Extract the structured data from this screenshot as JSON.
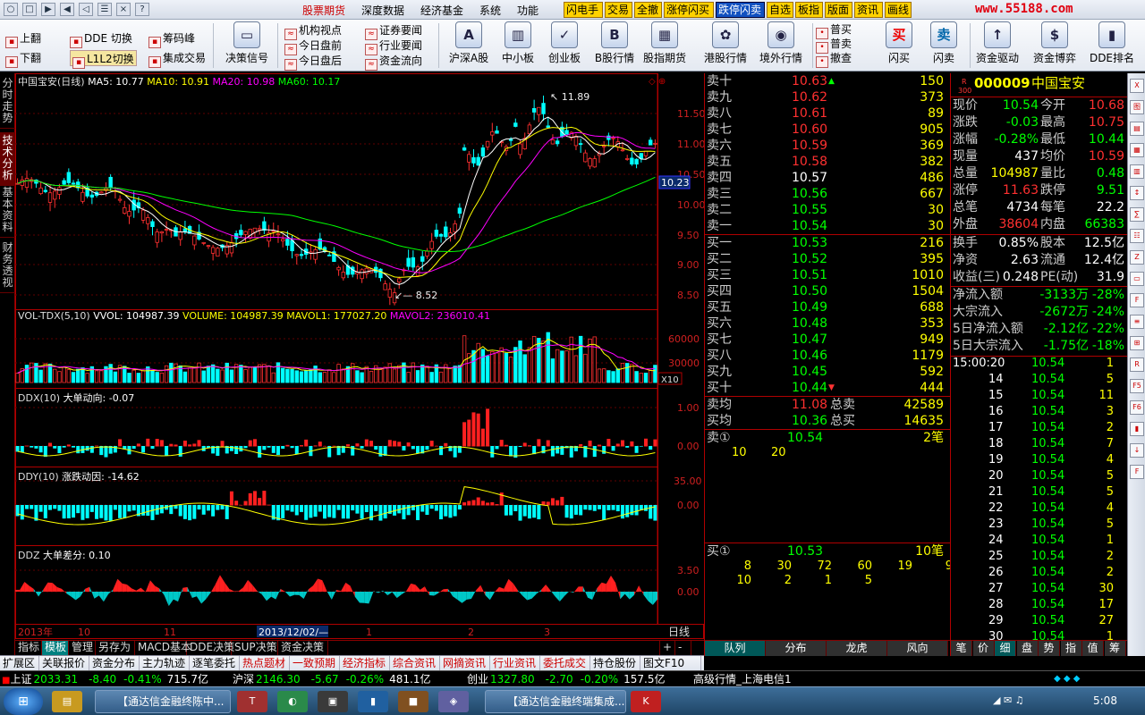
{
  "menubar": {
    "window_buttons": [
      "○",
      "□",
      "▶",
      "◀",
      "◁",
      "☰",
      "×",
      "?"
    ],
    "items": [
      {
        "label": "股票期货",
        "red": true
      },
      {
        "label": "深度数据",
        "red": false
      },
      {
        "label": "经济基金",
        "red": false
      },
      {
        "label": "系统",
        "red": false
      },
      {
        "label": "功能",
        "red": false
      }
    ],
    "highlight_buttons": [
      {
        "label": "闪电手",
        "blue": false
      },
      {
        "label": "交易",
        "blue": false
      },
      {
        "label": "全撤",
        "blue": false
      },
      {
        "label": "涨停闪买",
        "blue": false
      },
      {
        "label": "跌停闪卖",
        "blue": true
      },
      {
        "label": "自选",
        "blue": false
      },
      {
        "label": "板指",
        "blue": false
      },
      {
        "label": "版面",
        "blue": false
      },
      {
        "label": "资讯",
        "blue": false
      },
      {
        "label": "画线",
        "blue": false
      }
    ],
    "logo": "www.55188.com"
  },
  "toolbar": {
    "small_left": [
      "上翻",
      "下翻",
      "DDE 切换",
      "L1L2切换",
      "筹码峰",
      "集成交易"
    ],
    "decision": "决策信号",
    "small_news": [
      "机构视点",
      "今日盘前",
      "今日盘后",
      "证券要闻",
      "行业要闻",
      "资金流向"
    ],
    "buttons": [
      {
        "label": "沪深A股",
        "icon": "A"
      },
      {
        "label": "中小板",
        "icon": "▥"
      },
      {
        "label": "创业板",
        "icon": "✓"
      },
      {
        "label": "B股行情",
        "icon": "B"
      },
      {
        "label": "股指期货",
        "icon": "▦"
      },
      {
        "label": "港股行情",
        "icon": "✿"
      },
      {
        "label": "境外行情",
        "icon": "◉"
      }
    ],
    "trade_small": [
      "普买",
      "普卖",
      "撤查"
    ],
    "flash": [
      {
        "label": "闪买",
        "icon": "买"
      },
      {
        "label": "闪卖",
        "icon": "卖"
      }
    ],
    "right_buttons": [
      {
        "label": "资金驱动",
        "icon": "↑"
      },
      {
        "label": "资金博弈",
        "icon": "$"
      },
      {
        "label": "DDE排名",
        "icon": "▮"
      }
    ]
  },
  "left_tabs": [
    "分时走势",
    "技术分析",
    "基本资料",
    "财务透视"
  ],
  "main_chart": {
    "name": "中国宝安(日线)",
    "ma": [
      {
        "label": "MA5: 10.77",
        "color": "#ffffff"
      },
      {
        "label": "MA10: 10.91",
        "color": "#ffff00"
      },
      {
        "label": "MA20: 10.98",
        "color": "#ff00ff"
      },
      {
        "label": "MA60: 10.17",
        "color": "#00ff00"
      }
    ],
    "high_label": "11.89",
    "low_label": "8.52",
    "price_axis": [
      "11.50",
      "11.00",
      "10.50",
      "10.00",
      "9.50",
      "9.00",
      "8.50"
    ],
    "current_price": "10.23"
  },
  "vol_chart": {
    "title": "VOL-TDX(5,10)",
    "values": [
      {
        "label": "VVOL: 104987.39",
        "color": "#ffffff"
      },
      {
        "label": "VOLUME: 104987.39",
        "color": "#ffff00"
      },
      {
        "label": "MAVOL1: 177027.20",
        "color": "#ffff00"
      },
      {
        "label": "MAVOL2: 236010.41",
        "color": "#ff00ff"
      }
    ],
    "axis": [
      "60000",
      "30000"
    ],
    "unit": "X10"
  },
  "ddx_chart": {
    "title": "DDX(10)",
    "label": "大单动向: -0.07",
    "axis": [
      "1.00",
      "0.00"
    ]
  },
  "ddy_chart": {
    "title": "DDY(10)",
    "label": "涨跌动因: -14.62",
    "axis": [
      "35.00",
      "0.00"
    ]
  },
  "ddz_chart": {
    "title": "DDZ",
    "label": "大单差分: 0.10",
    "axis": [
      "3.50",
      "0.00"
    ]
  },
  "x_axis": {
    "labels": [
      "2013年",
      "10",
      "11",
      "2013/12/02/—",
      "1",
      "2",
      "3"
    ],
    "period": "日线"
  },
  "bottom_tabs1": [
    "指标",
    "模板",
    "管理",
    "另存为",
    "MACD基本",
    "DDE决策",
    "SUP决策",
    "资金决策"
  ],
  "bottom_tabs2": [
    "扩展区",
    "关联报价",
    "资金分布",
    "主力轨迹",
    "逐笔委托",
    "热点题材",
    "一致预期",
    "经济指标",
    "综合资讯",
    "网摘资讯",
    "行业资讯",
    "委托成交",
    "持仓股份",
    "图文F10"
  ],
  "orderbook": {
    "sell": [
      {
        "label": "卖十",
        "price": "10.63",
        "vol": "150",
        "arrow": "▲"
      },
      {
        "label": "卖九",
        "price": "10.62",
        "vol": "373"
      },
      {
        "label": "卖八",
        "price": "10.61",
        "vol": "89"
      },
      {
        "label": "卖七",
        "price": "10.60",
        "vol": "905"
      },
      {
        "label": "卖六",
        "price": "10.59",
        "vol": "369"
      },
      {
        "label": "卖五",
        "price": "10.58",
        "vol": "382"
      },
      {
        "label": "卖四",
        "price": "10.57",
        "vol": "486"
      },
      {
        "label": "卖三",
        "price": "10.56",
        "vol": "667"
      },
      {
        "label": "卖二",
        "price": "10.55",
        "vol": "30"
      },
      {
        "label": "卖一",
        "price": "10.54",
        "vol": "30"
      }
    ],
    "buy": [
      {
        "label": "买一",
        "price": "10.53",
        "vol": "216"
      },
      {
        "label": "买二",
        "price": "10.52",
        "vol": "395"
      },
      {
        "label": "买三",
        "price": "10.51",
        "vol": "1010"
      },
      {
        "label": "买四",
        "price": "10.50",
        "vol": "1504"
      },
      {
        "label": "买五",
        "price": "10.49",
        "vol": "688"
      },
      {
        "label": "买六",
        "price": "10.48",
        "vol": "353"
      },
      {
        "label": "买七",
        "price": "10.47",
        "vol": "949"
      },
      {
        "label": "买八",
        "price": "10.46",
        "vol": "1179"
      },
      {
        "label": "买九",
        "price": "10.45",
        "vol": "592"
      },
      {
        "label": "买十",
        "price": "10.44",
        "vol": "444",
        "arrow": "▼"
      }
    ],
    "avg": [
      {
        "label": "卖均",
        "price": "11.08",
        "total_label": "总卖",
        "total": "42589"
      },
      {
        "label": "买均",
        "price": "10.36",
        "total_label": "总买",
        "total": "14635"
      }
    ],
    "sell1_queue": {
      "label": "卖①",
      "price": "10.54",
      "count": "2笔",
      "orders": [
        "10",
        "20"
      ]
    },
    "buy1_queue": {
      "label": "买①",
      "price": "10.53",
      "count": "10笔",
      "orders": [
        [
          "8",
          "30",
          "72",
          "60",
          "19",
          "9"
        ],
        [
          "10",
          "2",
          "1",
          "5"
        ]
      ]
    },
    "bottom_tabs": [
      "队列",
      "分布",
      "龙虎",
      "风向"
    ]
  },
  "info": {
    "header_badge": "R\n300",
    "code": "000009",
    "name": "中国宝安",
    "rows": [
      [
        {
          "l": "现价",
          "v": "10.54",
          "c": "#00ff00"
        },
        {
          "l": "今开",
          "v": "10.68",
          "c": "#ff3030"
        }
      ],
      [
        {
          "l": "涨跌",
          "v": "-0.03",
          "c": "#00ff00"
        },
        {
          "l": "最高",
          "v": "10.75",
          "c": "#ff3030"
        }
      ],
      [
        {
          "l": "涨幅",
          "v": "-0.28%",
          "c": "#00ff00"
        },
        {
          "l": "最低",
          "v": "10.44",
          "c": "#00ff00"
        }
      ],
      [
        {
          "l": "现量",
          "v": "437",
          "c": "#ffffff"
        },
        {
          "l": "均价",
          "v": "10.59",
          "c": "#ff3030"
        }
      ],
      [
        {
          "l": "总量",
          "v": "104987",
          "c": "#ffff00"
        },
        {
          "l": "量比",
          "v": "0.48",
          "c": "#00ff00"
        }
      ],
      [
        {
          "l": "涨停",
          "v": "11.63",
          "c": "#ff3030"
        },
        {
          "l": "跌停",
          "v": "9.51",
          "c": "#00ff00"
        }
      ],
      [
        {
          "l": "总笔",
          "v": "4734",
          "c": "#ffffff"
        },
        {
          "l": "每笔",
          "v": "22.2",
          "c": "#ffffff"
        }
      ],
      [
        {
          "l": "外盘",
          "v": "38604",
          "c": "#ff3030"
        },
        {
          "l": "内盘",
          "v": "66383",
          "c": "#00ff00"
        }
      ]
    ],
    "rows2": [
      [
        {
          "l": "换手",
          "v": "0.85%",
          "c": "#ffffff"
        },
        {
          "l": "股本",
          "v": "12.5亿",
          "c": "#ffffff"
        }
      ],
      [
        {
          "l": "净资",
          "v": "2.63",
          "c": "#ffffff"
        },
        {
          "l": "流通",
          "v": "12.4亿",
          "c": "#ffffff"
        }
      ],
      [
        {
          "l": "收益(三)",
          "v": "0.248",
          "c": "#ffffff"
        },
        {
          "l": "PE(动)",
          "v": "31.9",
          "c": "#ffffff"
        }
      ]
    ],
    "flows": [
      {
        "l": "净流入额",
        "v": "-3133万",
        "p": "-28%"
      },
      {
        "l": "大宗流入",
        "v": "-2672万",
        "p": "-24%"
      },
      {
        "l": "5日净流入额",
        "v": "-2.12亿",
        "p": "-22%"
      },
      {
        "l": "5日大宗流入",
        "v": "-1.75亿",
        "p": "-18%"
      }
    ],
    "ticks": [
      {
        "t": "15:00:20",
        "p": "10.54",
        "v": "1"
      },
      {
        "t": "14",
        "p": "10.54",
        "v": "5"
      },
      {
        "t": "15",
        "p": "10.54",
        "v": "11"
      },
      {
        "t": "16",
        "p": "10.54",
        "v": "3"
      },
      {
        "t": "17",
        "p": "10.54",
        "v": "2"
      },
      {
        "t": "18",
        "p": "10.54",
        "v": "7"
      },
      {
        "t": "19",
        "p": "10.54",
        "v": "4"
      },
      {
        "t": "20",
        "p": "10.54",
        "v": "5"
      },
      {
        "t": "21",
        "p": "10.54",
        "v": "5"
      },
      {
        "t": "22",
        "p": "10.54",
        "v": "4"
      },
      {
        "t": "23",
        "p": "10.54",
        "v": "5"
      },
      {
        "t": "24",
        "p": "10.54",
        "v": "1"
      },
      {
        "t": "25",
        "p": "10.54",
        "v": "2"
      },
      {
        "t": "26",
        "p": "10.54",
        "v": "2"
      },
      {
        "t": "27",
        "p": "10.54",
        "v": "30"
      },
      {
        "t": "28",
        "p": "10.54",
        "v": "17"
      },
      {
        "t": "29",
        "p": "10.54",
        "v": "27"
      },
      {
        "t": "30",
        "p": "10.54",
        "v": "1"
      }
    ],
    "bottom_tabs": [
      "笔",
      "价",
      "细",
      "盘",
      "势",
      "指",
      "值",
      "筹"
    ]
  },
  "right_icons": [
    "X",
    "图",
    "▤",
    "▦",
    "▥",
    "↕",
    "∑",
    "☷",
    "Z",
    "▭",
    "F",
    "≡",
    "⊞",
    "R",
    "F5",
    "F6",
    "▮",
    "↓",
    "F"
  ],
  "ticker": {
    "items": [
      {
        "name": "上证",
        "val": "2033.31",
        "chg": "-8.40",
        "pct": "-0.41%",
        "amt": "715.7亿"
      },
      {
        "name": "沪深",
        "val": "2146.30",
        "chg": "-5.67",
        "pct": "-0.26%",
        "amt": "481.1亿"
      },
      {
        "name": "创业",
        "val": "1327.80",
        "chg": "-2.70",
        "pct": "-0.20%",
        "amt": "157.5亿"
      }
    ],
    "status": "高级行情_上海电信1"
  },
  "taskbar": {
    "apps": [
      "【通达信金融终陈中...",
      "【通达信金融终端集成..."
    ],
    "time": "5:08"
  }
}
